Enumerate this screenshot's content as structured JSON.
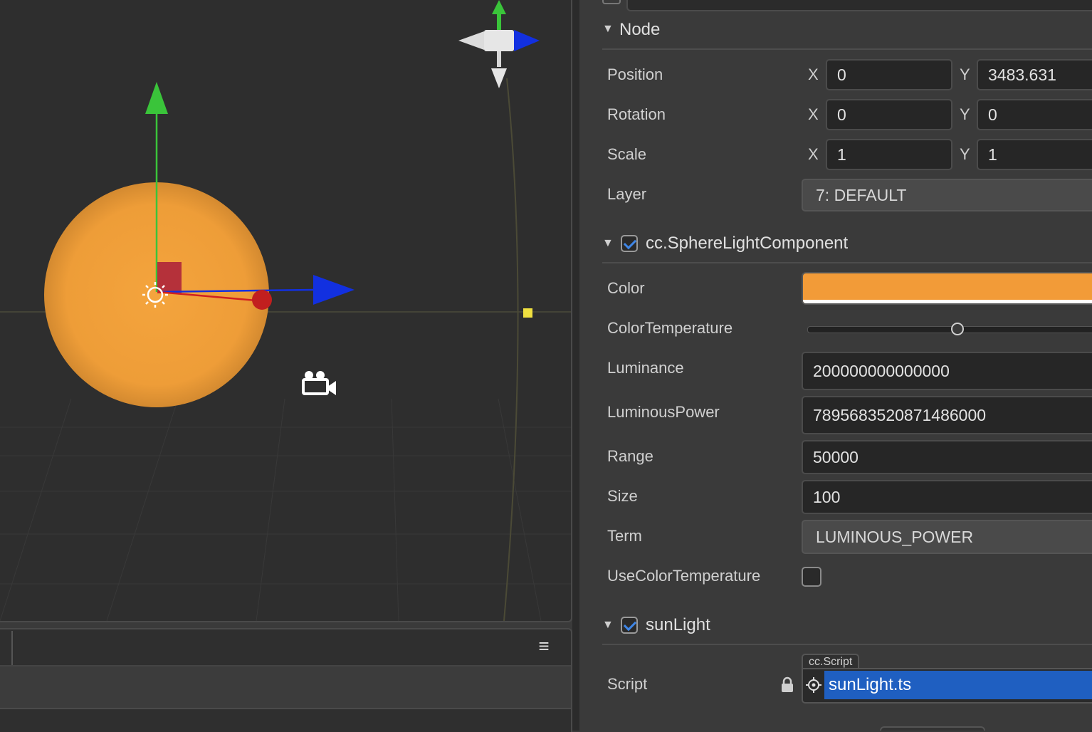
{
  "inspector": {
    "node_section": {
      "title": "Node",
      "collapse_icon": "triangle-down-icon"
    },
    "position": {
      "label": "Position",
      "x_axis": "X",
      "x": "0",
      "y_axis": "Y",
      "y": "3483.631"
    },
    "rotation": {
      "label": "Rotation",
      "x_axis": "X",
      "x": "0",
      "y_axis": "Y",
      "y": "0"
    },
    "scale": {
      "label": "Scale",
      "x_axis": "X",
      "x": "1",
      "y_axis": "Y",
      "y": "1"
    },
    "layer": {
      "label": "Layer",
      "value": "7: DEFAULT"
    },
    "light_section": {
      "title": "cc.SphereLightComponent",
      "enabled": true,
      "color": {
        "label": "Color",
        "value": "#f29b38"
      },
      "color_temperature": {
        "label": "ColorTemperature",
        "value_fraction": 0.5
      },
      "luminance": {
        "label": "Luminance",
        "value": "200000000000000"
      },
      "luminous_power": {
        "label": "LuminousPower",
        "value": "7895683520871486000"
      },
      "range": {
        "label": "Range",
        "value": "50000"
      },
      "size": {
        "label": "Size",
        "value": "100"
      },
      "term": {
        "label": "Term",
        "value": "LUMINOUS_POWER"
      },
      "use_color_temperature": {
        "label": "UseColorTemperature",
        "checked": false
      }
    },
    "script_section": {
      "title": "sunLight",
      "enabled": true,
      "script": {
        "label": "Script",
        "type_tag": "cc.Script",
        "value": "sunLight.ts",
        "lock_icon": "lock-icon",
        "locate_icon": "locate-icon"
      }
    }
  },
  "scene": {
    "sphere_color": "#f0a03a",
    "gizmo_colors": {
      "x": "#d02020",
      "y": "#3ac43a",
      "z": "#1230e0"
    },
    "icons": [
      "sun-light-icon",
      "camera-icon",
      "orientation-gizmo-icon"
    ]
  },
  "bottom_panel": {
    "menu_icon": "hamburger-menu-icon",
    "menu_glyph": "≡"
  }
}
